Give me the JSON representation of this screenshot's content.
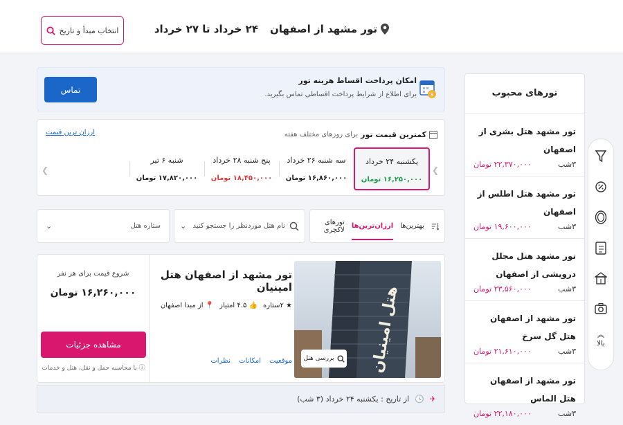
{
  "header": {
    "title": "تور مشهد از اصفهان",
    "date_range": "۲۴ خرداد تا ۲۷ خرداد",
    "pick_button": "انتخاب مبدأ و تاریخ"
  },
  "installments": {
    "title": "امکان پرداخت اقساط هزینه تور",
    "subtitle": "برای اطلاع از شرایط پرداخت اقساطی تماس بگیرید.",
    "contact_button": "تماس"
  },
  "cheapest": {
    "title": "کمترین قیمت تور",
    "subtitle": "برای روزهای مختلف هفته",
    "link": "ارزان ترین قیمت",
    "days": [
      {
        "name": "یکشنبه ۲۴ خرداد",
        "price": "۱۶,۲۵۰,۰۰۰ تومان",
        "color": "green",
        "selected": true
      },
      {
        "name": "سه شنبه ۲۶ خرداد",
        "price": "۱۶,۸۶۰,۰۰۰ تومان",
        "color": "dark",
        "selected": false
      },
      {
        "name": "پنج شنبه ۲۸ خرداد",
        "price": "۱۸,۴۵۰,۰۰۰ تومان",
        "color": "red",
        "selected": false
      },
      {
        "name": "شنبه ۶ تیر",
        "price": "۱۷,۸۲۰,۰۰۰ تومان",
        "color": "dark",
        "selected": false
      }
    ]
  },
  "filters": {
    "sort_best": "بهترین‌ها",
    "sort_cheapest": "ارزان‌ترین‌ها",
    "sort_luxury": "تورهای لاکچری",
    "search_placeholder": "نام هتل موردنظر را جستجو کنید",
    "star_label": "ستاره هتل"
  },
  "tour_card": {
    "name": "تور مشهد از اصفهان هتل امینیان",
    "stars": "۲ستاره",
    "rating": "۴.۵ امتیاز",
    "origin": "از مبدا اصفهان",
    "links": [
      "موقعیت",
      "امکانات",
      "نظرات"
    ],
    "price_label": "شروع قیمت برای هر نفر",
    "price": "۱۶,۲۶۰,۰۰۰ تومان",
    "details_button": "مشاهده جزئیات",
    "note": "با محاسبه حمل و نقل، هتل و خدمات",
    "review_button": "بررسی هتل",
    "hotel_sign": "هتل امینیان"
  },
  "date_row": {
    "text": "از تاریخ : یکشنبه ۲۴ خرداد (۳ شب)"
  },
  "popular": {
    "title": "تورهای محبوب",
    "items": [
      {
        "name": "تور مشهد هتل بشری از اصفهان",
        "price": "۲۲,۳۷۰,۰۰۰ تومان",
        "nights": "۳شب"
      },
      {
        "name": "تور مشهد هتل اطلس از اصفهان",
        "price": "۱۹,۶۰۰,۰۰۰ تومان",
        "nights": "۳شب"
      },
      {
        "name": "تور مشهد هتل مجلل درویشی از اصفهان",
        "price": "۲۳,۵۶۰,۰۰۰ تومان",
        "nights": "۳شب"
      },
      {
        "name": "تور مشهد از اصفهان هتل گل سرخ",
        "price": "۲۱,۶۱۰,۰۰۰ تومان",
        "nights": "۳شب"
      },
      {
        "name": "تور مشهد از اصفهان هتل الماس",
        "price": "۲۲,۱۸۰,۰۰۰ تومان",
        "nights": "۳شب"
      }
    ]
  },
  "side_nav": {
    "top_label": "بالا",
    "icons": [
      "filter-icon",
      "discount-icon",
      "coin-icon",
      "checklist-icon",
      "hotel-icon",
      "camera-icon",
      "arrow-up-icon"
    ]
  },
  "colors": {
    "brand": "#d9176f",
    "primary": "#1b67c9",
    "green": "#1d9d4c",
    "red": "#e23a3a"
  }
}
